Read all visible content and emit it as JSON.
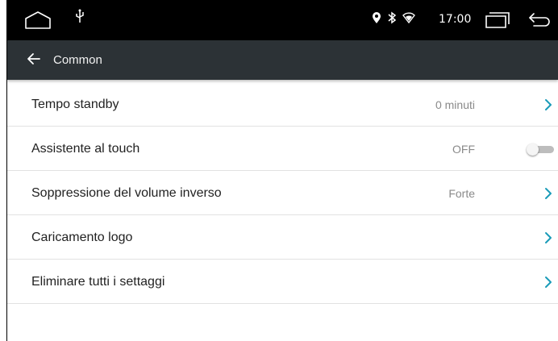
{
  "statusbar": {
    "time": "17:00",
    "icons": [
      "home-icon",
      "usb-icon",
      "location-icon",
      "bluetooth-icon",
      "wifi-icon",
      "recents-icon",
      "back-icon"
    ]
  },
  "header": {
    "title": "Common",
    "back_icon": "arrow-left-icon"
  },
  "settings": [
    {
      "label": "Tempo standby",
      "value": "0 minuti",
      "control": "chevron"
    },
    {
      "label": "Assistente al touch",
      "value": "OFF",
      "control": "toggle",
      "toggle_on": false
    },
    {
      "label": "Soppressione del volume inverso",
      "value": "Forte",
      "control": "chevron"
    },
    {
      "label": "Caricamento logo",
      "value": "",
      "control": "chevron"
    },
    {
      "label": "Eliminare tutti i settaggi",
      "value": "",
      "control": "chevron"
    }
  ],
  "colors": {
    "statusbar_bg": "#000000",
    "header_bg": "#2c3236",
    "accent": "#1a9bb8",
    "divider": "#e2e2e2"
  }
}
